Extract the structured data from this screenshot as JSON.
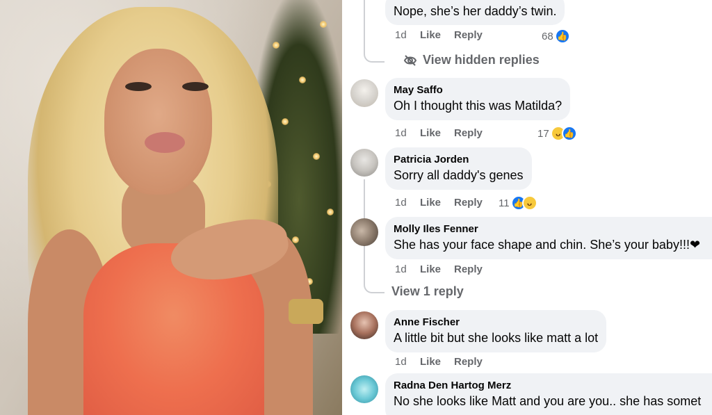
{
  "comments": [
    {
      "author": "",
      "text": "Nope, she’s her daddy’s twin.",
      "time": "1d",
      "like": "Like",
      "reply": "Reply",
      "reaction_count": "68",
      "reactions": [
        "like-reaction-icon"
      ]
    },
    {
      "author": "May Saffo",
      "text": "Oh I thought this was Matilda?",
      "time": "1d",
      "like": "Like",
      "reply": "Reply",
      "reaction_count": "17",
      "reactions": [
        "haha-reaction-icon",
        "like-reaction-icon"
      ]
    },
    {
      "author": "Patricia Jorden",
      "text": "Sorry all daddy's genes",
      "time": "1d",
      "like": "Like",
      "reply": "Reply",
      "reaction_count": "11",
      "reactions": [
        "like-reaction-icon",
        "haha-reaction-icon"
      ]
    },
    {
      "author": "Molly Iles Fenner",
      "text": "She has your face shape and chin. She’s your baby!!!❤",
      "time": "1d",
      "like": "Like",
      "reply": "Reply"
    },
    {
      "author": "Anne Fischer",
      "text": "A little bit but she looks like matt a lot",
      "time": "1d",
      "like": "Like",
      "reply": "Reply"
    },
    {
      "author": "Radna Den Hartog Merz",
      "text": "No she looks like Matt and you are you.. she has somet"
    }
  ],
  "view_hidden_replies": "View hidden replies",
  "view_1_reply": "View 1 reply",
  "colors": {
    "bubble_bg": "#f0f2f5",
    "meta_text": "#65676b",
    "like_blue": "#1877f2",
    "haha_yellow": "#f7c93c",
    "heart_red": "#e41e3f"
  }
}
